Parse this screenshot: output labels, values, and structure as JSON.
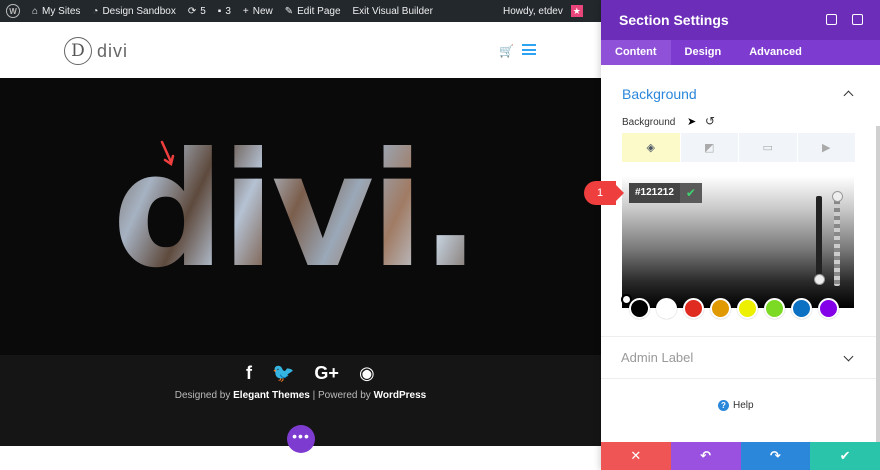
{
  "adminbar": {
    "my_sites": "My Sites",
    "site_name": "Design Sandbox",
    "updates": "5",
    "comments": "3",
    "new": "New",
    "edit_page": "Edit Page",
    "exit_vb": "Exit Visual Builder",
    "howdy": "Howdy, etdev"
  },
  "site": {
    "logo_letter": "D",
    "logo_text": "divi",
    "hero_word": "divi.",
    "credits_prefix": "Designed by",
    "credits_brand": "Elegant Themes",
    "credits_mid": "| Powered by",
    "credits_wp": "WordPress",
    "social": [
      "f",
      "t",
      "G+",
      "rss"
    ]
  },
  "panel": {
    "title": "Section Settings",
    "tabs": [
      "Content",
      "Design",
      "Advanced"
    ],
    "active_tab": "Content",
    "section_title": "Background",
    "bg_label": "Background",
    "color_value": "#121212",
    "callout_number": "1",
    "admin_label": "Admin Label",
    "help": "Help",
    "swatch_colors": [
      "#000000",
      "#ffffff",
      "#e02b20",
      "#e09900",
      "#edf000",
      "#7cda24",
      "#0c71c3",
      "#8300e9"
    ],
    "action_colors": [
      "#ef5555",
      "#9b51e0",
      "#2b87da",
      "#29c4a9"
    ]
  },
  "colors": {
    "accent": "#7e3bd0",
    "link": "#2b87da"
  }
}
